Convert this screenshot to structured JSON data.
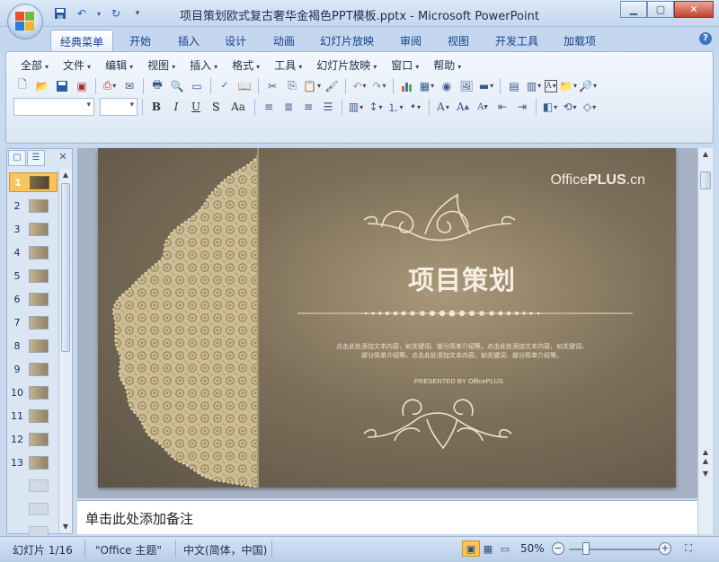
{
  "window": {
    "title": "项目策划欧式复古奢华金褐色PPT模板.pptx - Microsoft PowerPoint",
    "min_icon": "minimize-icon",
    "max_icon": "maximize-icon",
    "close_icon": "close-icon"
  },
  "ribbon_tabs": [
    "经典菜单",
    "开始",
    "插入",
    "设计",
    "动画",
    "幻灯片放映",
    "审阅",
    "视图",
    "开发工具",
    "加载项"
  ],
  "menu_bar": [
    "全部",
    "文件",
    "编辑",
    "视图",
    "插入",
    "格式",
    "工具",
    "幻灯片放映",
    "窗口",
    "帮助"
  ],
  "format_buttons": {
    "bold": "B",
    "italic": "I",
    "underline": "U",
    "shadow": "S",
    "case": "Aa"
  },
  "thumbnails": [
    "1",
    "2",
    "3",
    "4",
    "5",
    "6",
    "7",
    "8",
    "9",
    "10",
    "11",
    "12",
    "13"
  ],
  "slide": {
    "brand_prefix": "Office",
    "brand_bold": "PLUS",
    "brand_suffix": ".cn",
    "title": "项目策划",
    "body_line1": "点击此处添加文本内容，如关键词、部分简单介绍等。点击此处添加文本内容，如关键词、",
    "body_line2": "部分简单介绍等。点击此处添加文本内容，如关键词、部分简单介绍等。",
    "presented": "PRESENTED BY OfficePLUS"
  },
  "notes_placeholder": "单击此处添加备注",
  "status": {
    "slide_count": "幻灯片 1/16",
    "theme": "\"Office 主题\"",
    "language": "中文(简体，中国)",
    "zoom": "50%",
    "zoom_minus": "−",
    "zoom_plus": "+"
  },
  "colors": {
    "ribbon_blue": "#c4d7ef",
    "slide_brown": "#7d6f5a",
    "lace_gold": "#d2c29c",
    "active_orange": "#f7c55a"
  }
}
